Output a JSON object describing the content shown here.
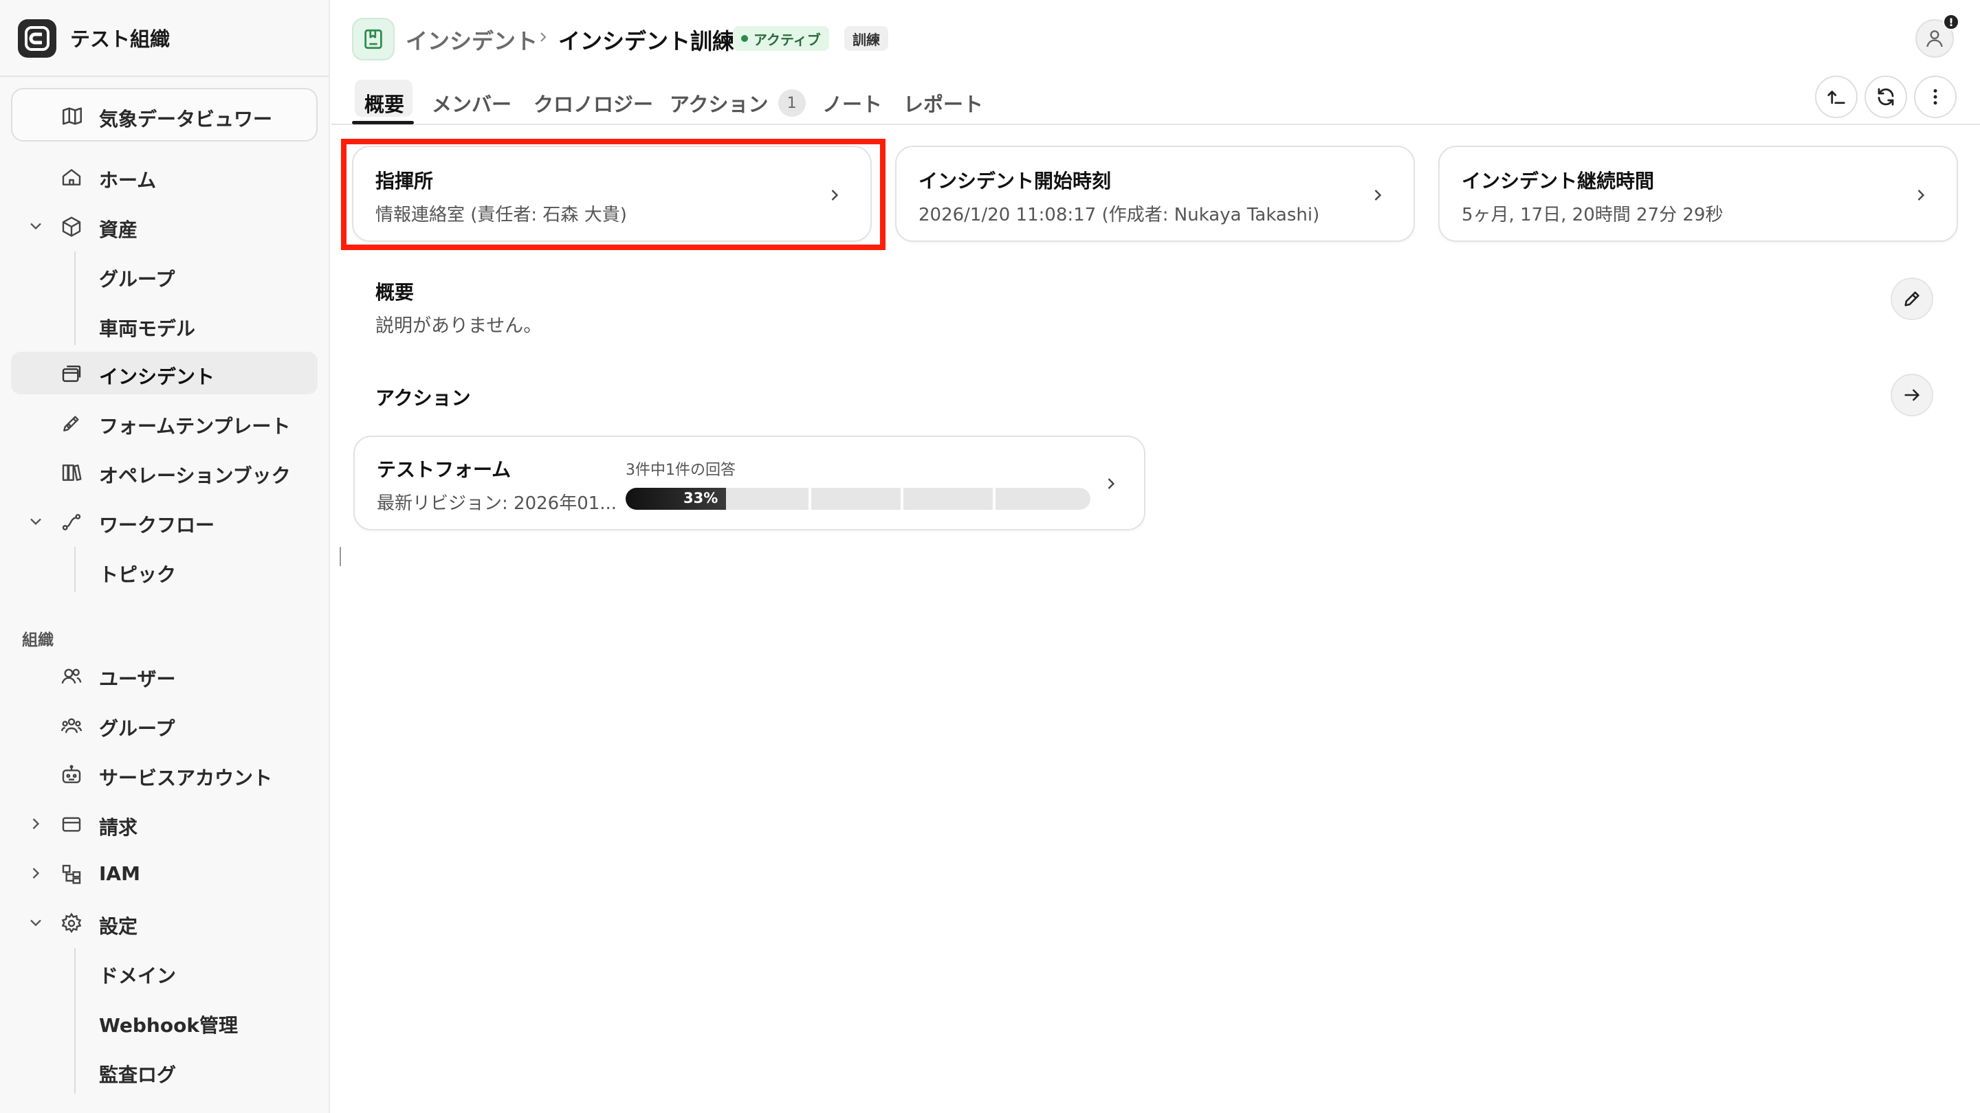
{
  "org": {
    "name": "テスト組織"
  },
  "sidebar": {
    "weather_viewer": "気象データビュワー",
    "items": [
      {
        "label": "ホーム",
        "icon": "home-icon"
      },
      {
        "label": "資産",
        "icon": "box-icon"
      },
      {
        "label": "グループ"
      },
      {
        "label": "車両モデル"
      },
      {
        "label": "インシデント",
        "icon": "window-stack-icon",
        "active": true
      },
      {
        "label": "フォームテンプレート",
        "icon": "pen-icon"
      },
      {
        "label": "オペレーションブック",
        "icon": "books-icon"
      },
      {
        "label": "ワークフロー",
        "icon": "workflow-icon"
      },
      {
        "label": "トピック"
      }
    ],
    "section_org": "組織",
    "org_items": [
      {
        "label": "ユーザー",
        "icon": "users-icon"
      },
      {
        "label": "グループ",
        "icon": "group-icon"
      },
      {
        "label": "サービスアカウント",
        "icon": "bot-icon"
      },
      {
        "label": "請求",
        "icon": "card-icon"
      },
      {
        "label": "IAM",
        "icon": "iam-icon"
      },
      {
        "label": "設定",
        "icon": "gear-icon"
      },
      {
        "label": "ドメイン"
      },
      {
        "label": "Webhook管理"
      },
      {
        "label": "監査ログ"
      }
    ]
  },
  "header": {
    "breadcrumb_parent": "インシデント",
    "breadcrumb_current": "インシデント訓練",
    "status_badge": "アクティブ",
    "training_badge": "訓練",
    "avatar_alert": "!"
  },
  "tabs": [
    {
      "label": "概要",
      "active": true
    },
    {
      "label": "メンバー"
    },
    {
      "label": "クロノロジー"
    },
    {
      "label": "アクション",
      "count": "1"
    },
    {
      "label": "ノート"
    },
    {
      "label": "レポート"
    }
  ],
  "cards": [
    {
      "title": "指揮所",
      "value": "情報連絡室 (責任者: 石森 大貴)"
    },
    {
      "title": "インシデント開始時刻",
      "value": "2026/1/20 11:08:17 (作成者: Nukaya Takashi)"
    },
    {
      "title": "インシデント継続時間",
      "value": "5ヶ月, 17日, 20時間 27分 29秒"
    }
  ],
  "overview": {
    "title": "概要",
    "description": "説明がありません。"
  },
  "actions": {
    "title": "アクション",
    "form": {
      "name": "テストフォーム",
      "revision": "最新リビジョン: 2026年01...",
      "responses": "3件中1件の回答",
      "progress_label": "33%",
      "progress_fraction": 0.33
    }
  },
  "colors": {
    "highlight": "#ff1e0a",
    "active_badge_bg": "#e3f6e8",
    "accent_dark": "#1a1a1a"
  }
}
